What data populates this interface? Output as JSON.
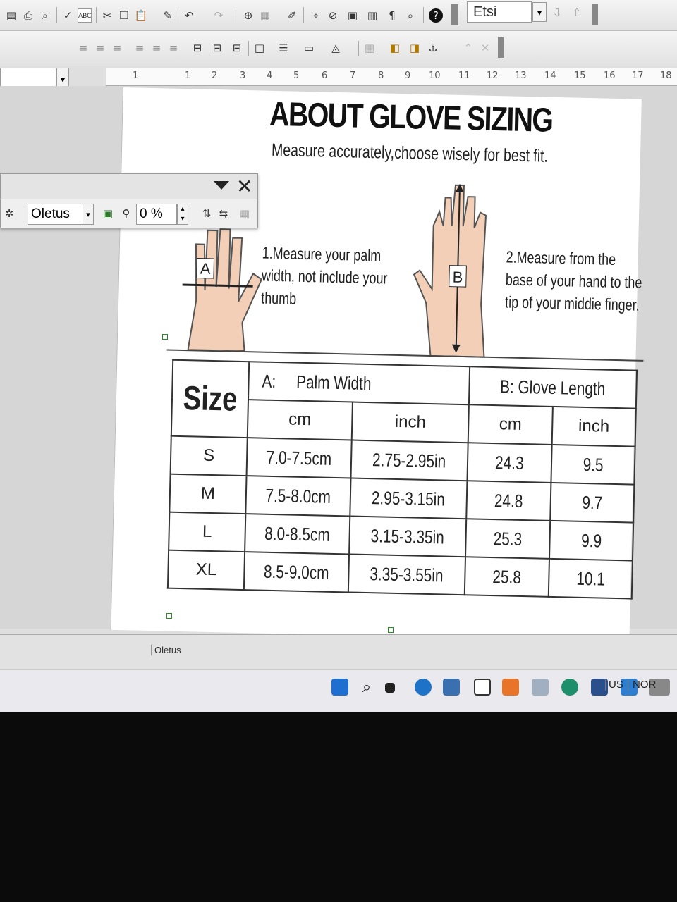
{
  "toolbar": {
    "search_text": "Etsi",
    "style_value": ""
  },
  "ruler": {
    "numbers": [
      "1",
      "1",
      "2",
      "3",
      "4",
      "5",
      "6",
      "7",
      "8",
      "9",
      "10",
      "11",
      "12",
      "13",
      "14",
      "15",
      "16",
      "17",
      "18"
    ]
  },
  "panel": {
    "style_value": "Oletus",
    "percent_value": "0 %"
  },
  "document": {
    "title": "ABOUT GLOVE SIZING",
    "subtitle": "Measure accurately,choose wisely for best fit.",
    "step1_line1": "1.Measure your palm",
    "step1_line2": "width, not include your",
    "step1_line3": "thumb",
    "step2_line1": "2.Measure from the",
    "step2_line2": "base of your hand to the",
    "step2_line3": "tip of your middie finger.",
    "hand1_label": "A",
    "hand2_label": "B",
    "table": {
      "size_header": "Size",
      "a_prefix": "A:",
      "a_header": "Palm Width",
      "b_header": "B:  Glove Length",
      "units": [
        "cm",
        "inch",
        "cm",
        "inch"
      ],
      "rows": [
        {
          "size": "S",
          "palm_cm": "7.0-7.5cm",
          "palm_in": "2.75-2.95in",
          "len_cm": "24.3",
          "len_in": "9.5"
        },
        {
          "size": "M",
          "palm_cm": "7.5-8.0cm",
          "palm_in": "2.95-3.15in",
          "len_cm": "24.8",
          "len_in": "9.7"
        },
        {
          "size": "L",
          "palm_cm": "8.0-8.5cm",
          "palm_in": "3.15-3.35in",
          "len_cm": "25.3",
          "len_in": "9.9"
        },
        {
          "size": "XL",
          "palm_cm": "8.5-9.0cm",
          "palm_in": "3.35-3.55in",
          "len_cm": "25.8",
          "len_in": "10.1"
        }
      ]
    }
  },
  "statusbar": {
    "style_name": "Oletus"
  },
  "taskbar": {
    "lang_1": "US",
    "lang_2": "NOR"
  }
}
